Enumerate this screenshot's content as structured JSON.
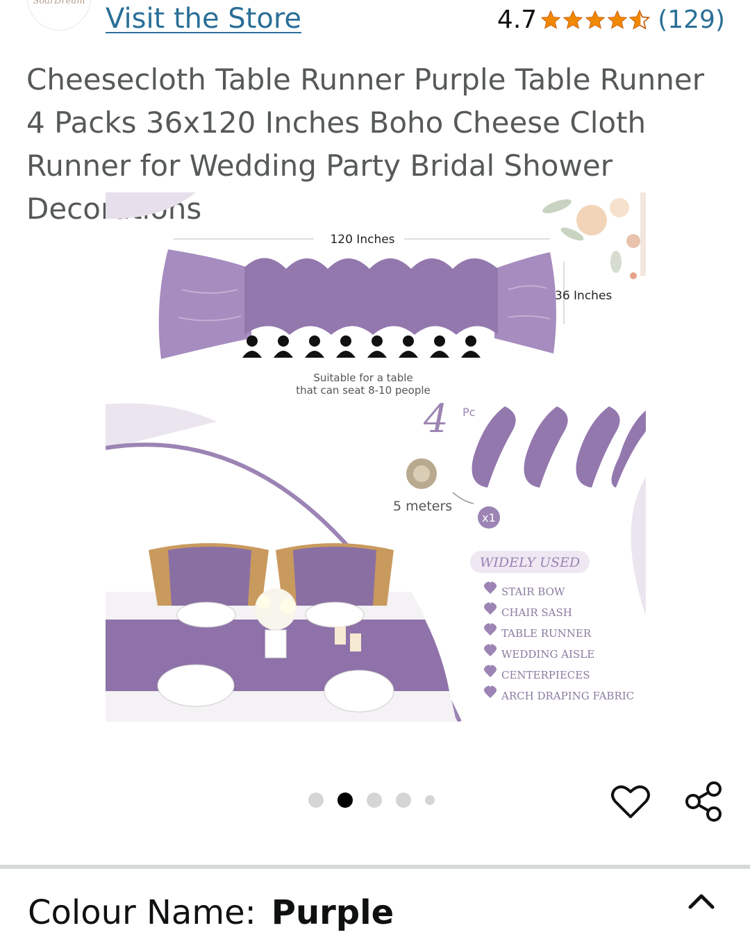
{
  "store": {
    "logo_text": "SoarDream",
    "visit_label": "Visit the Store"
  },
  "rating": {
    "value": "4.7",
    "stars": 4.7,
    "count": "(129)",
    "star_color": "#f08804"
  },
  "product": {
    "title": "Cheesecloth Table Runner Purple Table Runner 4 Packs 36x120 Inches Boho Cheese Cloth Runner for Wedding Party Bridal Shower Decorations"
  },
  "image": {
    "length_label": "120 Inches",
    "width_label": "36 Inches",
    "seat_line1": "Suitable for a table",
    "seat_line2": "that can seat 8-10 people",
    "pack_number": "4",
    "pack_unit": "Pc",
    "twine_label": "5 meters",
    "twine_qty": "x1",
    "uses_heading": "WIDELY USED",
    "uses": [
      "STAIR BOW",
      "CHAIR SASH",
      "TABLE RUNNER",
      "WEDDING AISLE",
      "CENTERPIECES",
      "ARCH DRAPING FABRIC"
    ],
    "accent_color": "#9c84b4"
  },
  "carousel": {
    "total": 5,
    "active_index": 1
  },
  "colour": {
    "label": "Colour Name:",
    "value": "Purple"
  },
  "colors": {
    "link": "#2a6f97",
    "title_text": "#565959",
    "divider": "#d5d9d9"
  }
}
